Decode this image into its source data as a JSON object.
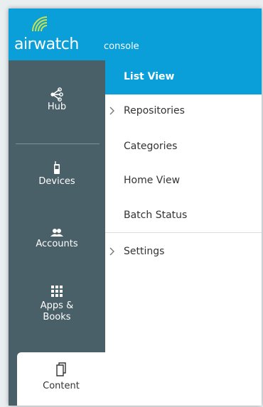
{
  "header": {
    "logo_text": "airwatch",
    "console_label": "console"
  },
  "sidebar": {
    "items": [
      {
        "label": "Hub",
        "icon": "hub-icon"
      },
      {
        "label": "Devices",
        "icon": "device-icon"
      },
      {
        "label": "Accounts",
        "icon": "accounts-icon"
      },
      {
        "label": "Apps &",
        "label2": "Books",
        "icon": "apps-grid-icon"
      },
      {
        "label": "Content",
        "icon": "content-icon",
        "active": true
      }
    ]
  },
  "submenu": {
    "items": [
      {
        "label": "List View",
        "selected": true
      },
      {
        "label": "Repositories",
        "expandable": true
      },
      {
        "label": "Categories"
      },
      {
        "label": "Home View"
      },
      {
        "label": "Batch Status"
      },
      {
        "label": "Settings",
        "expandable": true
      }
    ]
  },
  "colors": {
    "accent": "#0a9fd8",
    "sidebar": "#4a6068",
    "text": "#333333"
  }
}
